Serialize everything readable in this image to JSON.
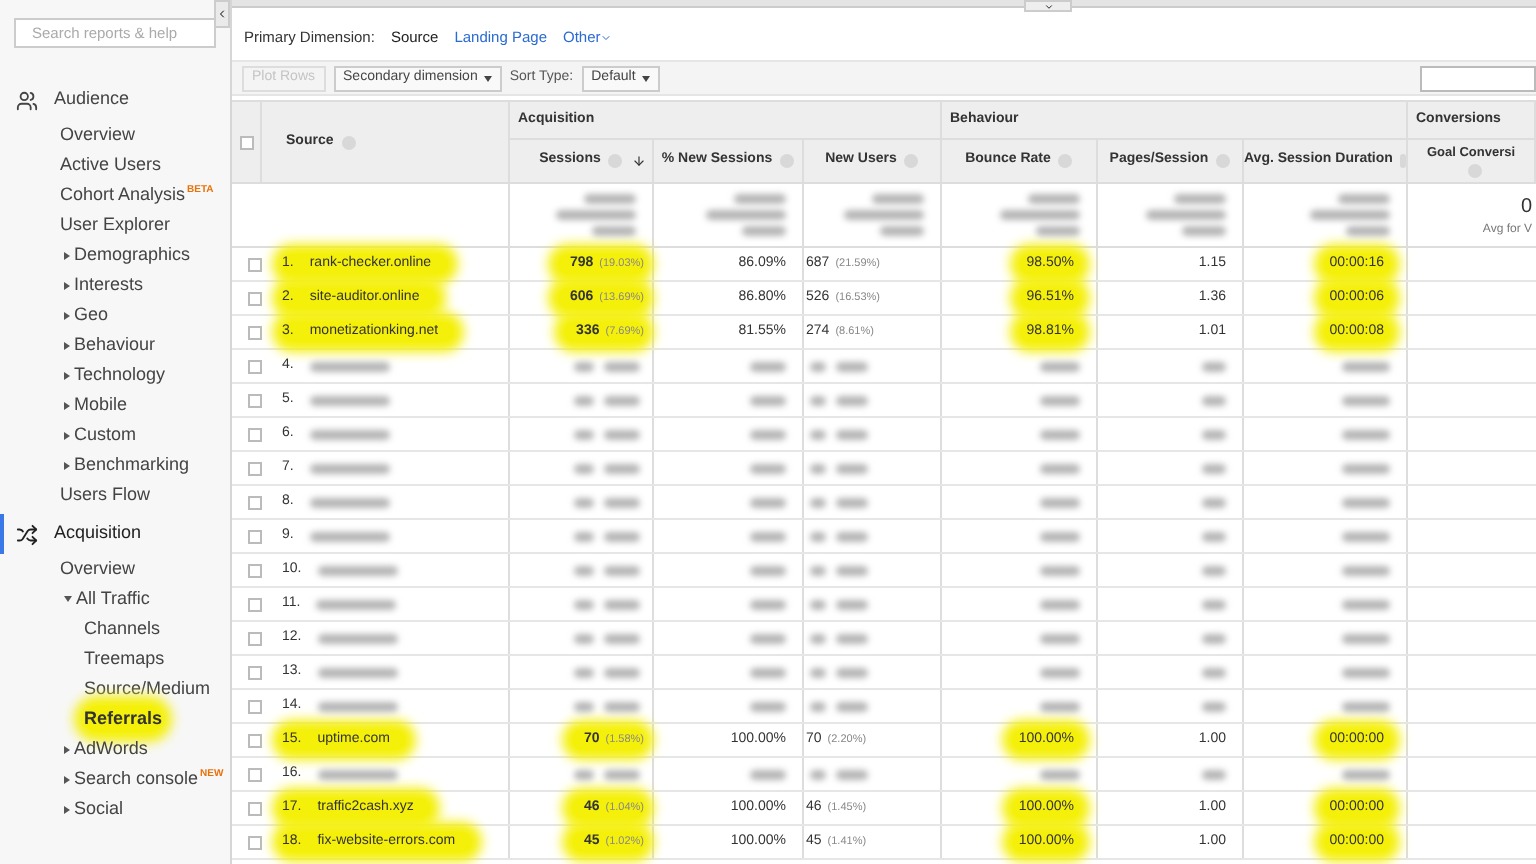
{
  "sidebar": {
    "search": {
      "placeholder": "Search reports & help"
    },
    "sections": [
      {
        "label": "Audience",
        "selected": false,
        "items": [
          {
            "label": "Overview",
            "kind": "link",
            "selected": false
          },
          {
            "label": "Active Users",
            "kind": "link",
            "selected": false
          },
          {
            "label": "Cohort Analysis",
            "kind": "link",
            "selected": false,
            "badge": "BETA"
          },
          {
            "label": "User Explorer",
            "kind": "link",
            "selected": false
          },
          {
            "label": "Demographics",
            "kind": "group",
            "expanded": false,
            "selected": false
          },
          {
            "label": "Interests",
            "kind": "group",
            "expanded": false,
            "selected": false
          },
          {
            "label": "Geo",
            "kind": "group",
            "expanded": false,
            "selected": false
          },
          {
            "label": "Behaviour",
            "kind": "group",
            "expanded": false,
            "selected": false
          },
          {
            "label": "Technology",
            "kind": "group",
            "expanded": false,
            "selected": false
          },
          {
            "label": "Mobile",
            "kind": "group",
            "expanded": false,
            "selected": false
          },
          {
            "label": "Custom",
            "kind": "group",
            "expanded": false,
            "selected": false
          },
          {
            "label": "Benchmarking",
            "kind": "group",
            "expanded": false,
            "selected": false
          },
          {
            "label": "Users Flow",
            "kind": "link",
            "selected": false
          }
        ]
      },
      {
        "label": "Acquisition",
        "selected": true,
        "items": [
          {
            "label": "Overview",
            "kind": "link",
            "selected": false
          },
          {
            "label": "All Traffic",
            "kind": "group",
            "expanded": true,
            "selected": false,
            "children": [
              {
                "label": "Channels",
                "kind": "link",
                "selected": false
              },
              {
                "label": "Treemaps",
                "kind": "link",
                "selected": false
              },
              {
                "label": "Source/Medium",
                "kind": "link",
                "selected": false
              },
              {
                "label": "Referrals",
                "kind": "link",
                "selected": true
              }
            ]
          },
          {
            "label": "AdWords",
            "kind": "group",
            "expanded": false,
            "selected": false
          },
          {
            "label": "Search console",
            "kind": "group",
            "expanded": false,
            "selected": false,
            "badge": "NEW"
          },
          {
            "label": "Social",
            "kind": "group",
            "expanded": false,
            "selected": false
          }
        ]
      }
    ]
  },
  "primary_dimension": {
    "label": "Primary Dimension:",
    "options": [
      {
        "label": "Source",
        "selected": true
      },
      {
        "label": "Landing Page",
        "selected": false
      },
      {
        "label": "Other",
        "selected": false
      }
    ]
  },
  "toolbar": {
    "plot_rows": {
      "label": "Plot Rows",
      "disabled": true
    },
    "secondary_dimension": "Secondary dimension",
    "sort_type_label": "Sort Type:",
    "sort_type": "Default"
  },
  "table": {
    "select_all_checked": false,
    "source_header": "Source",
    "groups": [
      {
        "label": "Acquisition",
        "columns": [
          {
            "label": "Sessions",
            "sorted": true
          },
          {
            "label": "% New Sessions",
            "sorted": false
          },
          {
            "label": "New Users",
            "sorted": false
          }
        ]
      },
      {
        "label": "Behaviour",
        "columns": [
          {
            "label": "Bounce Rate",
            "sorted": false
          },
          {
            "label": "Pages/Session",
            "sorted": false
          },
          {
            "label": "Avg. Session Duration",
            "sorted": false
          }
        ]
      },
      {
        "label": "Conversions",
        "columns": [
          {
            "label": "Goal Conversi",
            "sorted": false
          }
        ]
      }
    ],
    "summary": {
      "conversion_value": "0",
      "conversion_note": "Avg for V"
    },
    "rows": [
      {
        "kind": "shown",
        "index": "1.",
        "source": "rank-checker.online",
        "sessions": "798",
        "sessions_pct": "(19.03%)",
        "new_sessions": "86.09%",
        "new_users": "687",
        "new_users_pct": "(21.59%)",
        "bounce_rate": "98.50%",
        "pages_session": "1.15",
        "duration": "00:00:16",
        "highlighted": true,
        "checked": false
      },
      {
        "kind": "shown",
        "index": "2.",
        "source": "site-auditor.online",
        "sessions": "606",
        "sessions_pct": "(13.69%)",
        "new_sessions": "86.80%",
        "new_users": "526",
        "new_users_pct": "(16.53%)",
        "bounce_rate": "96.51%",
        "pages_session": "1.36",
        "duration": "00:00:06",
        "highlighted": true,
        "checked": false
      },
      {
        "kind": "shown",
        "index": "3.",
        "source": "monetizationking.net",
        "sessions": "336",
        "sessions_pct": "(7.69%)",
        "new_sessions": "81.55%",
        "new_users": "274",
        "new_users_pct": "(8.61%)",
        "bounce_rate": "98.81%",
        "pages_session": "1.01",
        "duration": "00:00:08",
        "highlighted": true,
        "checked": false
      },
      {
        "kind": "blurred",
        "index": "4.",
        "checked": false
      },
      {
        "kind": "blurred",
        "index": "5.",
        "checked": false
      },
      {
        "kind": "blurred",
        "index": "6.",
        "checked": false
      },
      {
        "kind": "blurred",
        "index": "7.",
        "checked": false
      },
      {
        "kind": "blurred",
        "index": "8.",
        "checked": false
      },
      {
        "kind": "blurred",
        "index": "9.",
        "checked": false
      },
      {
        "kind": "blurred",
        "index": "10.",
        "checked": false
      },
      {
        "kind": "blurred",
        "index": "11.",
        "checked": false
      },
      {
        "kind": "blurred",
        "index": "12.",
        "checked": false
      },
      {
        "kind": "blurred",
        "index": "13.",
        "checked": false
      },
      {
        "kind": "blurred",
        "index": "14.",
        "checked": false
      },
      {
        "kind": "shown",
        "index": "15.",
        "source": "uptime.com",
        "sessions": "70",
        "sessions_pct": "(1.58%)",
        "new_sessions": "100.00%",
        "new_users": "70",
        "new_users_pct": "(2.20%)",
        "bounce_rate": "100.00%",
        "pages_session": "1.00",
        "duration": "00:00:00",
        "highlighted": true,
        "checked": false
      },
      {
        "kind": "blurred",
        "index": "16.",
        "checked": false
      },
      {
        "kind": "shown",
        "index": "17.",
        "source": "traffic2cash.xyz",
        "sessions": "46",
        "sessions_pct": "(1.04%)",
        "new_sessions": "100.00%",
        "new_users": "46",
        "new_users_pct": "(1.45%)",
        "bounce_rate": "100.00%",
        "pages_session": "1.00",
        "duration": "00:00:00",
        "highlighted": true,
        "checked": false
      },
      {
        "kind": "shown",
        "index": "18.",
        "source": "fix-website-errors.com",
        "sessions": "45",
        "sessions_pct": "(1.02%)",
        "new_sessions": "100.00%",
        "new_users": "45",
        "new_users_pct": "(1.41%)",
        "bounce_rate": "100.00%",
        "pages_session": "1.00",
        "duration": "00:00:00",
        "highlighted": true,
        "checked": false
      }
    ]
  }
}
